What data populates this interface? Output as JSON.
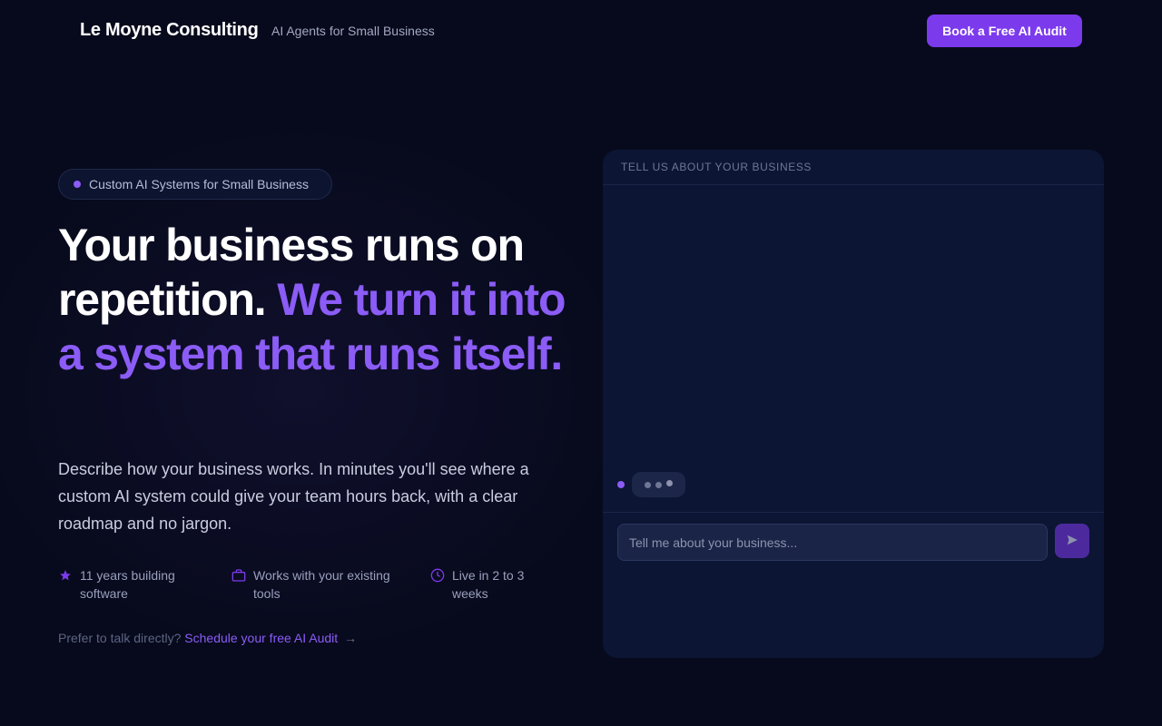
{
  "header": {
    "brand": "Le Moyne Consulting",
    "tagline": "AI Agents for Small Business",
    "cta_label": "Book a Free AI Audit"
  },
  "hero": {
    "badge": "Custom AI Systems for Small Business",
    "headline_plain": "Your business runs on repetition.",
    "headline_accent": "We turn it into a system that runs itself.",
    "description": "Describe how your business works. In minutes you'll see where a custom AI system could give your team hours back, with a clear roadmap and no jargon.",
    "features": [
      {
        "icon": "star-icon",
        "text": "11 years building software"
      },
      {
        "icon": "briefcase-icon",
        "text": "Works with your existing tools"
      },
      {
        "icon": "clock-icon",
        "text": "Live in 2 to 3 weeks"
      }
    ],
    "talk_prefix": "Prefer to talk directly?",
    "talk_link": "Schedule your free AI Audit",
    "talk_arrow": "→"
  },
  "chat": {
    "header": "TELL US ABOUT YOUR BUSINESS",
    "input_placeholder": "Tell me about your business...",
    "send_icon": "send-icon"
  },
  "colors": {
    "background": "#070a1c",
    "accent": "#8b5cf6",
    "button": "#7c3aed",
    "panel": "#0c1533"
  }
}
